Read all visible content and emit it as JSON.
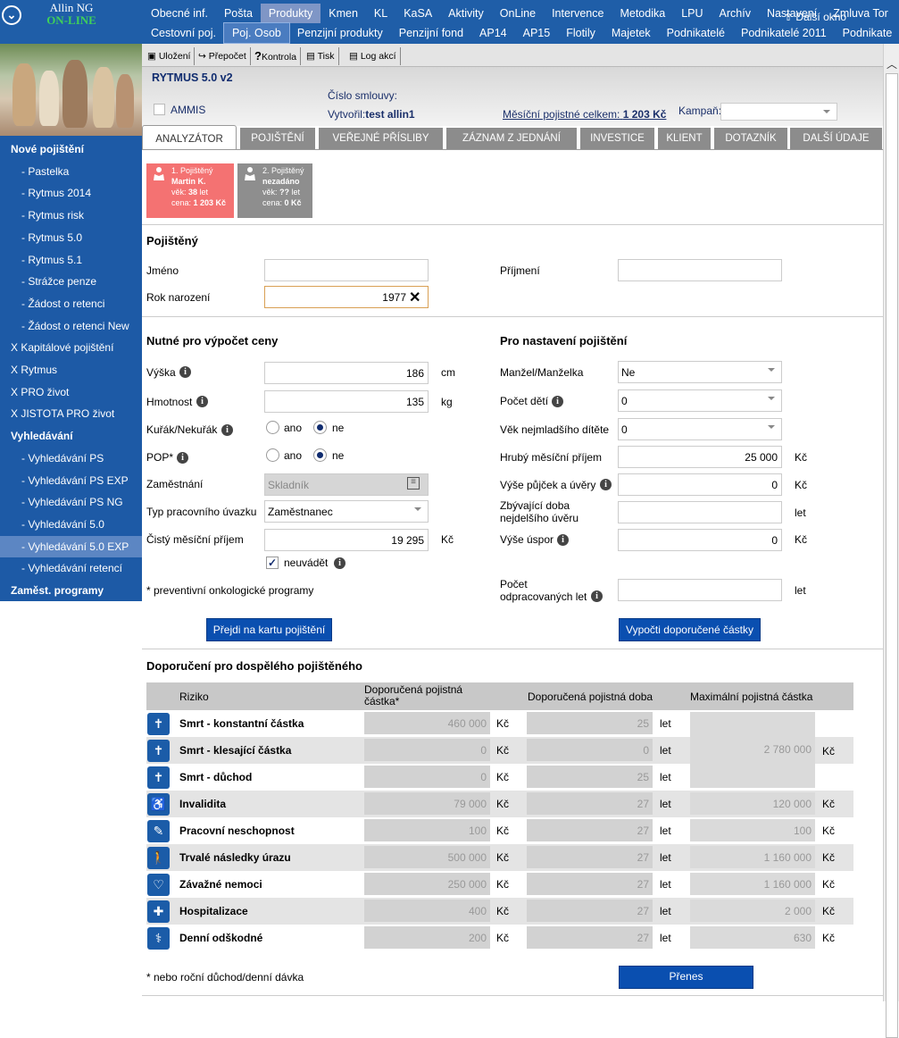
{
  "app": {
    "name": "Allin NG",
    "status": "ON-LINE"
  },
  "topmenu": {
    "row1": [
      "Obecné inf.",
      "Pošta",
      "Produkty",
      "Kmen",
      "KL",
      "KaSA",
      "Aktivity",
      "OnLine",
      "Intervence",
      "Metodika",
      "LPU",
      "Archív",
      "Nastavení",
      "Zmluva Tor"
    ],
    "row2": [
      "Cestovní poj.",
      "Poj. Osob",
      "Penzijní produkty",
      "Penzijní fond",
      "AP14",
      "AP15",
      "Flotily",
      "Majetek",
      "Podnikatelé",
      "Podnikatelé 2011",
      "Podnikate"
    ],
    "next_window": "Další okno"
  },
  "sidebar": {
    "items": [
      {
        "label": "Nové pojištění",
        "kind": "h"
      },
      {
        "label": "- Pastelka",
        "kind": "s"
      },
      {
        "label": "- Rytmus 2014",
        "kind": "s"
      },
      {
        "label": "- Rytmus risk",
        "kind": "s"
      },
      {
        "label": "- Rytmus 5.0",
        "kind": "s"
      },
      {
        "label": "- Rytmus 5.1",
        "kind": "s"
      },
      {
        "label": "- Strážce penze",
        "kind": "s"
      },
      {
        "label": "- Žádost o retenci",
        "kind": "s"
      },
      {
        "label": "- Žádost o retenci New",
        "kind": "s"
      },
      {
        "label": "X Kapitálové pojištění",
        "kind": "x"
      },
      {
        "label": "X Rytmus",
        "kind": "x"
      },
      {
        "label": "X PRO život",
        "kind": "x"
      },
      {
        "label": "X JISTOTA PRO život",
        "kind": "x"
      },
      {
        "label": "Vyhledávání",
        "kind": "h"
      },
      {
        "label": "- Vyhledávání PS",
        "kind": "s"
      },
      {
        "label": "- Vyhledávání PS EXP",
        "kind": "s"
      },
      {
        "label": "- Vyhledávání PS NG",
        "kind": "s"
      },
      {
        "label": "- Vyhledávání 5.0",
        "kind": "s"
      },
      {
        "label": "- Vyhledávání 5.0 EXP",
        "kind": "s",
        "active": true
      },
      {
        "label": "- Vyhledávání retencí",
        "kind": "s"
      },
      {
        "label": "Zaměst. programy",
        "kind": "h"
      }
    ]
  },
  "toolbar": {
    "save": "Uložení",
    "recalc": "Přepočet",
    "check": "Kontrola",
    "print": "Tisk",
    "log": "Log akcí"
  },
  "header": {
    "title": "RYTMUS 5.0 v2",
    "ammis": "AMMIS",
    "contract_label": "Číslo smlouvy:",
    "created_label": "Vytvořil:",
    "created_value": "test allin1",
    "premium_label": "Měsíční pojistné celkem:",
    "premium_value": "1 203 Kč",
    "campaign_label": "Kampaň:"
  },
  "tabs": [
    "ANALYZÁTOR",
    "POJIŠTĚNÍ",
    "VEŘEJNÉ PŘÍSLIBY",
    "ZÁZNAM Z JEDNÁNÍ",
    "INVESTICE",
    "KLIENT",
    "DOTAZNÍK",
    "DALŠÍ ÚDAJE"
  ],
  "insured": [
    {
      "line1": "1. Pojištěný",
      "line2": "Martin K.",
      "age_label": "věk: ",
      "age": "38",
      "age_unit": " let",
      "price_label": "cena: ",
      "price": "1 203 Kč"
    },
    {
      "line1": "2. Pojištěný",
      "line2": "nezadáno",
      "age_label": "věk: ",
      "age": "??",
      "age_unit": " let",
      "price_label": "cena: ",
      "price": "0 Kč"
    }
  ],
  "pojisteny": {
    "title": "Pojištěný",
    "first_name_label": "Jméno",
    "first_name": "",
    "last_name_label": "Příjmení",
    "last_name": "",
    "birth_year_label": "Rok narození",
    "birth_year": "1977"
  },
  "price": {
    "title": "Nutné pro výpočet ceny",
    "height_label": "Výška",
    "height": "186",
    "height_unit": "cm",
    "weight_label": "Hmotnost",
    "weight": "135",
    "weight_unit": "kg",
    "smoker_label": "Kuřák/Nekuřák",
    "yes": "ano",
    "no": "ne",
    "pop_label": "POP*",
    "employment_label": "Zaměstnání",
    "employment": "Skladník",
    "worktype_label": "Typ pracovního úvazku",
    "worktype": "Zaměstnanec",
    "net_income_label": "Čistý měsíční příjem",
    "net_income": "19 295",
    "currency": "Kč",
    "not_state": "neuvádět",
    "footnote": "* preventivní onkologické programy",
    "button": "Přejdi na kartu pojištění"
  },
  "settings": {
    "title": "Pro nastavení pojištění",
    "spouse_label": "Manžel/Manželka",
    "spouse": "Ne",
    "children_label": "Počet dětí",
    "children": "0",
    "youngest_label": "Věk nejmladšího dítěte",
    "youngest": "0",
    "gross_label": "Hrubý měsíční příjem",
    "gross": "25 000",
    "loans_label": "Výše půjček a úvěry",
    "loans": "0",
    "remaining_label_1": "Zbývající doba",
    "remaining_label_2": "nejdelšího úvěru",
    "remaining": "",
    "savings_label": "Výše úspor",
    "savings": "0",
    "years_label_1": "Počet",
    "years_label_2": "odpracovaných let",
    "years": "",
    "currency": "Kč",
    "years_unit": "let",
    "button": "Vypočti doporučené částky"
  },
  "recommend": {
    "title": "Doporučení pro dospělého pojištěného",
    "col_risk": "Riziko",
    "col_amount": "Doporučená pojistná částka*",
    "col_period": "Doporučená pojistná doba",
    "col_max": "Maximální pojistná částka",
    "currency": "Kč",
    "unit_years": "let",
    "merged_max": "2 780 000",
    "rows": [
      {
        "risk": "Smrt - konstantní částka",
        "amount": "460 000",
        "period": "25",
        "max": "",
        "icon": "cross-icon"
      },
      {
        "risk": "Smrt - klesající částka",
        "amount": "0",
        "period": "0",
        "max": "",
        "icon": "cross-icon"
      },
      {
        "risk": "Smrt - důchod",
        "amount": "0",
        "period": "25",
        "max": "",
        "icon": "cross-icon"
      },
      {
        "risk": "Invalidita",
        "amount": "79 000",
        "period": "27",
        "max": "120 000",
        "icon": "wheelchair-icon"
      },
      {
        "risk": "Pracovní neschopnost",
        "amount": "100",
        "period": "27",
        "max": "100",
        "icon": "pen-icon"
      },
      {
        "risk": "Trvalé následky úrazu",
        "amount": "500 000",
        "period": "27",
        "max": "1 160 000",
        "icon": "walker-icon"
      },
      {
        "risk": "Závažné nemoci",
        "amount": "250 000",
        "period": "27",
        "max": "1 160 000",
        "icon": "heart-icon"
      },
      {
        "risk": "Hospitalizace",
        "amount": "400",
        "period": "27",
        "max": "2 000",
        "icon": "medkit-icon"
      },
      {
        "risk": "Denní odškodné",
        "amount": "200",
        "period": "27",
        "max": "630",
        "icon": "crutch-icon"
      }
    ],
    "footnote": "* nebo roční důchod/denní dávka",
    "button": "Přenes"
  }
}
